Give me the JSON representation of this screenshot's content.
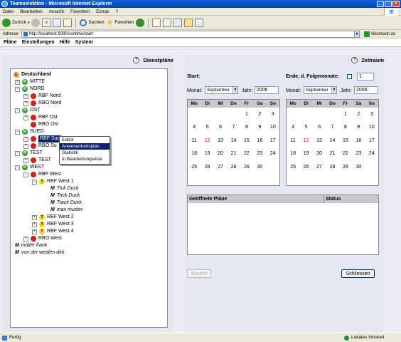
{
  "window": {
    "title": "Teamselektion - Microsoft Internet Explorer"
  },
  "ie_menu": [
    "Datei",
    "Bearbeiten",
    "Ansicht",
    "Favoriten",
    "Extras",
    "?"
  ],
  "ie_toolbar": {
    "back": "Zurück",
    "search": "Suchen",
    "favorites": "Favoriten"
  },
  "address": {
    "label": "Adresse",
    "url": "http://localhost:8080/contime/start",
    "go": "Wechseln zu"
  },
  "app_menu": [
    "Pläne",
    "Einstellungen",
    "Hilfe",
    "System"
  ],
  "left_panel": {
    "title": "Dienstpläne",
    "tree": {
      "root": "Deutschland",
      "mitte": "MITTE",
      "nord": "NORD",
      "rbf_nord": "RBF Nord",
      "rbo_nord": "RBO Nord",
      "ost": "OST",
      "rbf_ost": "RBF Ost",
      "rbo_ost": "RBO Ost",
      "sued": "SUED",
      "rbf_sued": "RBF Sud",
      "rbo_sued": "RBO Su",
      "test": "TEST",
      "test_child": "TEST",
      "west": "WEST",
      "rbf_west": "RBF West",
      "rbf_west_1": "RBF West 1",
      "tick": "Tick Duck",
      "trick": "Trick Duck",
      "track": "Track Duck",
      "max": "max muster",
      "rbf_west_2": "RBF West 2",
      "rbf_west_3": "RBF West 3",
      "rbf_west_4": "RBF West 4",
      "rbo_west": "RBO West",
      "mueller": "müller frank",
      "weiden": "von der weiden dirk"
    },
    "context_menu": [
      "Editor",
      "Anwesenheitsplan",
      "Statistik",
      "in Bearbeitungsliste"
    ]
  },
  "right_panel": {
    "title": "Zeitraum",
    "start_label": "Start:",
    "end_label": "Ende, d. Folgemonate:",
    "end_value": "1",
    "month_label": "Monat:",
    "year_label": "Jahr:",
    "start_month": "September",
    "start_year": "2006",
    "end_month": "September",
    "end_year": "2006",
    "weekdays": [
      "Mo",
      "Di",
      "Mi",
      "Do",
      "Fr",
      "Sa",
      "So"
    ],
    "days": [
      "",
      "",
      "",
      "",
      "1",
      "2",
      "3",
      "4",
      "5",
      "6",
      "7",
      "8",
      "9",
      "10",
      "11",
      "12",
      "13",
      "14",
      "15",
      "16",
      "17",
      "18",
      "19",
      "20",
      "21",
      "22",
      "23",
      "24",
      "25",
      "26",
      "27",
      "28",
      "29",
      "30",
      ""
    ],
    "table": {
      "col_plans": "Geöffnete Pläne",
      "col_status": "Status"
    },
    "btn_view": "Ansicht",
    "btn_close": "Schliessen"
  },
  "status": {
    "left": "Fertig",
    "right": "Lokales Intranet"
  }
}
